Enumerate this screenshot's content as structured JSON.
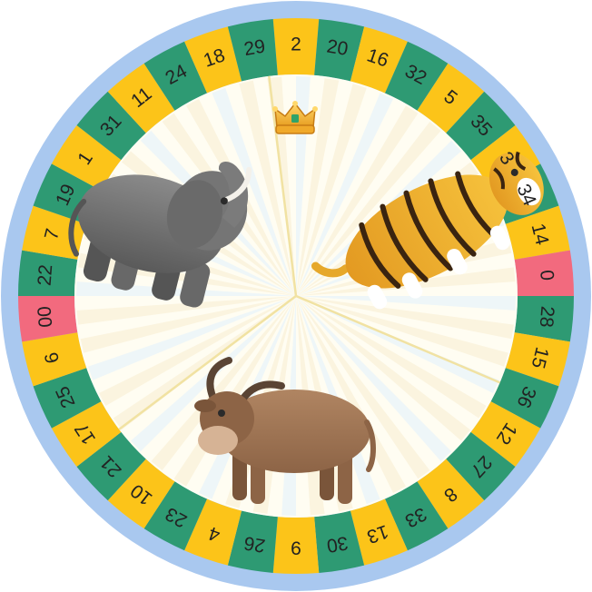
{
  "wheel": {
    "numbers": [
      {
        "label": "2",
        "color": "yellow"
      },
      {
        "label": "20",
        "color": "green"
      },
      {
        "label": "16",
        "color": "yellow"
      },
      {
        "label": "32",
        "color": "green"
      },
      {
        "label": "5",
        "color": "yellow"
      },
      {
        "label": "35",
        "color": "green"
      },
      {
        "label": "3",
        "color": "yellow"
      },
      {
        "label": "34",
        "color": "green"
      },
      {
        "label": "14",
        "color": "yellow"
      },
      {
        "label": "0",
        "color": "red"
      },
      {
        "label": "28",
        "color": "green"
      },
      {
        "label": "15",
        "color": "yellow"
      },
      {
        "label": "36",
        "color": "green"
      },
      {
        "label": "12",
        "color": "yellow"
      },
      {
        "label": "27",
        "color": "green"
      },
      {
        "label": "8",
        "color": "yellow"
      },
      {
        "label": "33",
        "color": "green"
      },
      {
        "label": "13",
        "color": "yellow"
      },
      {
        "label": "30",
        "color": "green"
      },
      {
        "label": "9",
        "color": "yellow"
      },
      {
        "label": "26",
        "color": "green"
      },
      {
        "label": "4",
        "color": "yellow"
      },
      {
        "label": "23",
        "color": "green"
      },
      {
        "label": "10",
        "color": "yellow"
      },
      {
        "label": "21",
        "color": "green"
      },
      {
        "label": "17",
        "color": "yellow"
      },
      {
        "label": "25",
        "color": "green"
      },
      {
        "label": "6",
        "color": "yellow"
      },
      {
        "label": "00",
        "color": "red"
      },
      {
        "label": "22",
        "color": "green"
      },
      {
        "label": "7",
        "color": "yellow"
      },
      {
        "label": "19",
        "color": "green"
      },
      {
        "label": "1",
        "color": "yellow"
      },
      {
        "label": "31",
        "color": "green"
      },
      {
        "label": "11",
        "color": "yellow"
      },
      {
        "label": "24",
        "color": "green"
      },
      {
        "label": "18",
        "color": "yellow"
      },
      {
        "label": "29",
        "color": "green"
      }
    ],
    "sections": [
      {
        "animal": "tiger",
        "icon": "tiger-icon"
      },
      {
        "animal": "ox",
        "icon": "ox-icon"
      },
      {
        "animal": "elephant",
        "icon": "elephant-icon"
      }
    ],
    "marker_icon": "crown-icon"
  },
  "colors": {
    "green": "#2e9a73",
    "yellow": "#fcc419",
    "red": "#f26a7e",
    "outer_ring": "#a9c8ef",
    "inner_bg": "#fffdf2",
    "divider": "#f1e2a2"
  }
}
